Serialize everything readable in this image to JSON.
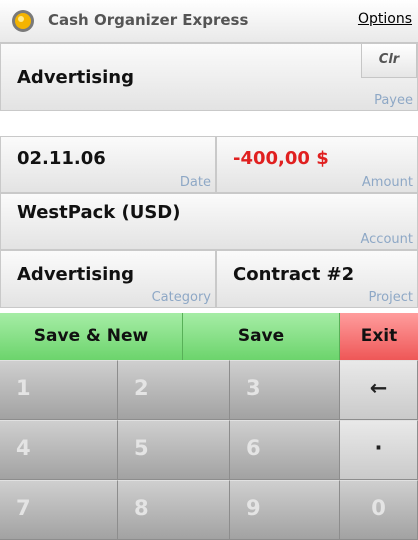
{
  "app": {
    "title": "Cash Organizer Express",
    "options_label": "Options"
  },
  "payee": {
    "value": "Advertising",
    "label": "Payee",
    "clear_label": "Clr"
  },
  "date": {
    "value": "02.11.06",
    "label": "Date"
  },
  "amount": {
    "value": "-400,00 $",
    "label": "Amount",
    "color": "#e02020"
  },
  "account": {
    "value": "WestPack (USD)",
    "label": "Account"
  },
  "category": {
    "value": "Advertising",
    "label": "Category"
  },
  "project": {
    "value": "Contract #2",
    "label": "Project"
  },
  "actions": {
    "save_new": "Save & New",
    "save": "Save",
    "exit": "Exit"
  },
  "keypad": {
    "k1": "1",
    "k2": "2",
    "k3": "3",
    "backspace": "←",
    "k4": "4",
    "k5": "5",
    "k6": "6",
    "decimal": "·",
    "k7": "7",
    "k8": "8",
    "k9": "9",
    "k0": "0"
  }
}
